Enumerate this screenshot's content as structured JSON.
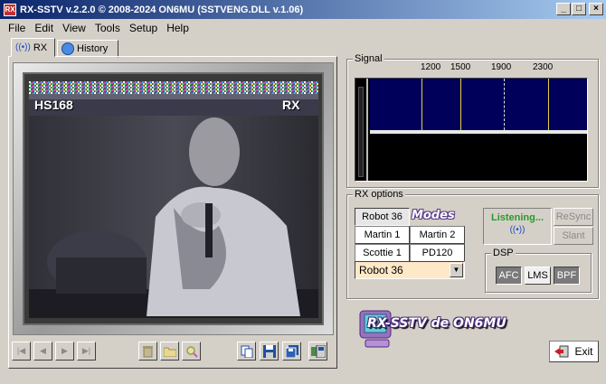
{
  "window": {
    "title": "RX-SSTV v.2.2.0 © 2008-2024 ON6MU (SSTVENG.DLL v.1.06)",
    "app_icon_text": "RX",
    "minimize": "_",
    "maximize": "□",
    "close": "×"
  },
  "menu": {
    "items": [
      {
        "label": "File"
      },
      {
        "label": "Edit"
      },
      {
        "label": "View"
      },
      {
        "label": "Tools"
      },
      {
        "label": "Setup"
      },
      {
        "label": "Help"
      }
    ]
  },
  "tabs": {
    "rx": "RX",
    "history": "History"
  },
  "image": {
    "header_left": "HS168",
    "header_right": "RX"
  },
  "toolbar": {
    "first": "|◀",
    "prev": "◀",
    "next": "▶",
    "last": "▶|"
  },
  "signal": {
    "label": "Signal",
    "freqs": [
      "1200",
      "1500",
      "1900",
      "2300"
    ]
  },
  "rx_options": {
    "label": "RX options",
    "modes_label": "Modes",
    "buttons": [
      "Robot 36",
      "Martin 1",
      "Martin 2",
      "Scottie 1",
      "PD120"
    ],
    "selected_mode": "Robot 36",
    "select_arrow": "▼"
  },
  "status": {
    "listening": "Listening...",
    "resync": "ReSync",
    "slant": "Slant"
  },
  "dsp": {
    "label": "DSP",
    "afc": "AFC",
    "lms": "LMS",
    "bpf": "BPF"
  },
  "logo": {
    "text": "RX-SSTV de ON6MU"
  },
  "exit": {
    "label": "Exit"
  },
  "colors": {
    "titlebar_start": "#0a246a",
    "listening": "#2a9a2a",
    "spectrum_bg": "#00005a",
    "spectrum_marker": "#e0d040"
  }
}
